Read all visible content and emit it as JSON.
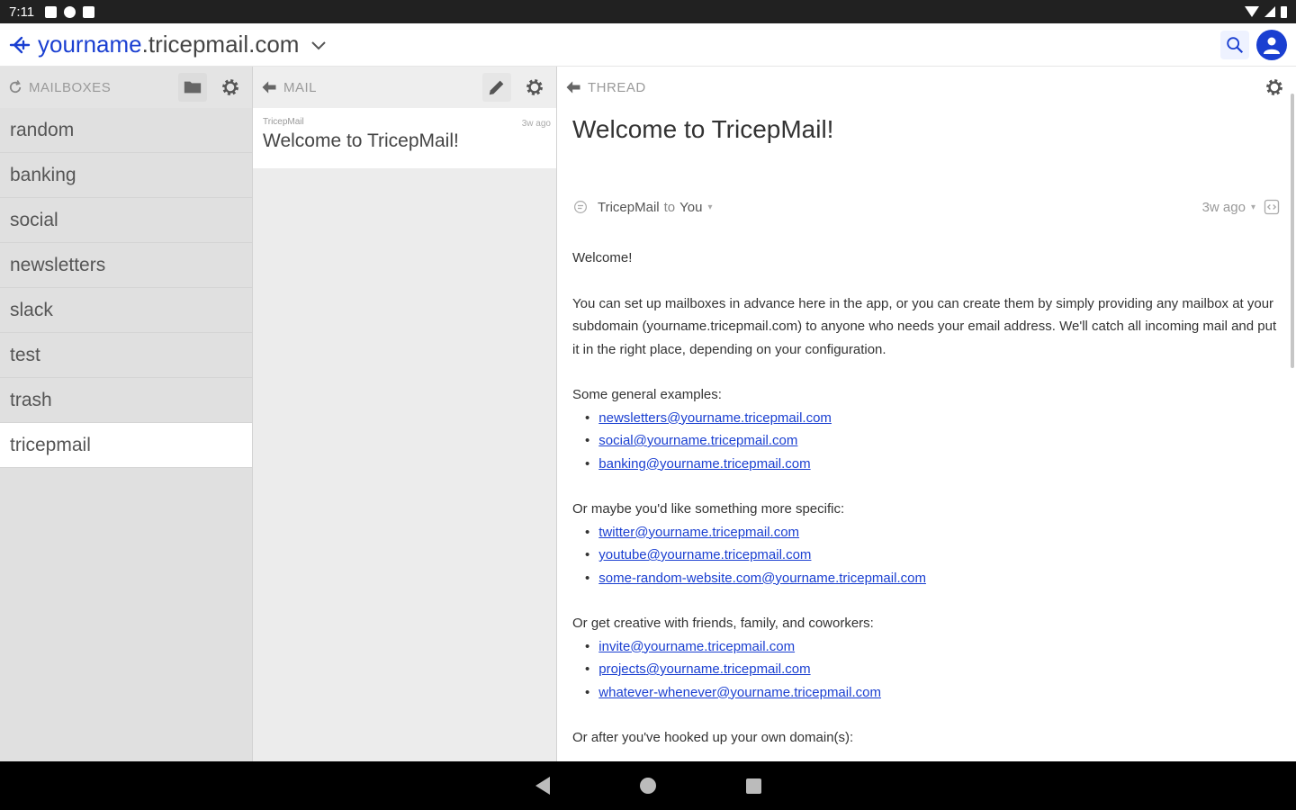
{
  "status_bar": {
    "time": "7:11"
  },
  "header": {
    "domain_user": "yourname",
    "domain_rest": ".tricepmail.com"
  },
  "mailboxes": {
    "title": "MAILBOXES",
    "items": [
      {
        "label": "random"
      },
      {
        "label": "banking"
      },
      {
        "label": "social"
      },
      {
        "label": "newsletters"
      },
      {
        "label": "slack"
      },
      {
        "label": "test"
      },
      {
        "label": "trash"
      },
      {
        "label": "tricepmail"
      }
    ],
    "selected": "tricepmail"
  },
  "mail": {
    "title": "MAIL",
    "items": [
      {
        "sender": "TricepMail",
        "time": "3w ago",
        "subject": "Welcome to TricepMail!"
      }
    ]
  },
  "thread": {
    "title": "THREAD",
    "subject": "Welcome to TricepMail!",
    "from": "TricepMail",
    "to_word": "to",
    "to": "You",
    "time": "3w ago",
    "greeting": "Welcome!",
    "intro": "You can set up mailboxes in advance here in the app, or you can create them by simply providing any mailbox at your subdomain (yourname.tricepmail.com) to anyone who needs your email address. We'll catch all incoming mail and put it in the right place, depending on your configuration.",
    "section1_label": "Some general examples:",
    "section1_links": [
      "newsletters@yourname.tricepmail.com",
      "social@yourname.tricepmail.com",
      "banking@yourname.tricepmail.com"
    ],
    "section2_label": "Or maybe you'd like something more specific:",
    "section2_links": [
      "twitter@yourname.tricepmail.com",
      "youtube@yourname.tricepmail.com",
      "some-random-website.com@yourname.tricepmail.com"
    ],
    "section3_label": "Or get creative with friends, family, and coworkers:",
    "section3_links": [
      "invite@yourname.tricepmail.com",
      "projects@yourname.tricepmail.com",
      "whatever-whenever@yourname.tricepmail.com"
    ],
    "section4_label": "Or after you've hooked up your own domain(s):"
  }
}
